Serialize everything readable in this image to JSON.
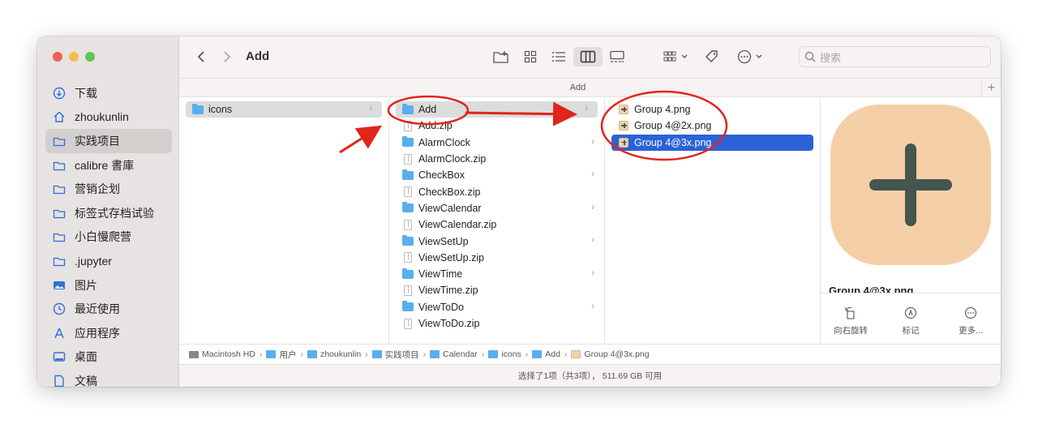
{
  "window": {
    "title": "Add",
    "path_title": "Add",
    "search_placeholder": "搜索"
  },
  "sidebar": {
    "items": [
      {
        "label": "下载",
        "icon": "download-icon"
      },
      {
        "label": "zhoukunlin",
        "icon": "home-icon"
      },
      {
        "label": "实践项目",
        "icon": "folder-icon",
        "selected": true
      },
      {
        "label": "calibre 書庫",
        "icon": "folder-icon"
      },
      {
        "label": "营销企划",
        "icon": "folder-icon"
      },
      {
        "label": "标签式存档试验",
        "icon": "folder-icon"
      },
      {
        "label": "小白慢爬营",
        "icon": "folder-icon"
      },
      {
        "label": ".jupyter",
        "icon": "folder-icon"
      },
      {
        "label": "图片",
        "icon": "photo-icon"
      },
      {
        "label": "最近使用",
        "icon": "clock-icon"
      },
      {
        "label": "应用程序",
        "icon": "apps-icon"
      },
      {
        "label": "桌面",
        "icon": "desktop-icon"
      },
      {
        "label": "文稿",
        "icon": "document-icon"
      }
    ]
  },
  "columns": {
    "col1": [
      {
        "label": "icons",
        "type": "folder",
        "chevron": true,
        "selected": "gray"
      }
    ],
    "col2": [
      {
        "label": "Add",
        "type": "folder",
        "chevron": true,
        "selected": "gray"
      },
      {
        "label": "Add.zip",
        "type": "zip"
      },
      {
        "label": "AlarmClock",
        "type": "folder",
        "chevron": true
      },
      {
        "label": "AlarmClock.zip",
        "type": "zip"
      },
      {
        "label": "CheckBox",
        "type": "folder",
        "chevron": true
      },
      {
        "label": "CheckBox.zip",
        "type": "zip"
      },
      {
        "label": "ViewCalendar",
        "type": "folder",
        "chevron": true
      },
      {
        "label": "ViewCalendar.zip",
        "type": "zip"
      },
      {
        "label": "ViewSetUp",
        "type": "folder",
        "chevron": true
      },
      {
        "label": "ViewSetUp.zip",
        "type": "zip"
      },
      {
        "label": "ViewTime",
        "type": "folder",
        "chevron": true
      },
      {
        "label": "ViewTime.zip",
        "type": "zip"
      },
      {
        "label": "ViewToDo",
        "type": "folder",
        "chevron": true
      },
      {
        "label": "ViewToDo.zip",
        "type": "zip"
      }
    ],
    "col3": [
      {
        "label": "Group 4.png",
        "type": "png"
      },
      {
        "label": "Group 4@2x.png",
        "type": "png"
      },
      {
        "label": "Group 4@3x.png",
        "type": "png",
        "selected": "blue"
      }
    ]
  },
  "preview": {
    "filename": "Group 4@3x.png",
    "image_bg": "#f4cfa6",
    "image_fg": "#45554f",
    "actions": [
      {
        "label": "向右旋转",
        "icon": "rotate-icon"
      },
      {
        "label": "标记",
        "icon": "markup-icon"
      },
      {
        "label": "更多...",
        "icon": "more-icon"
      }
    ]
  },
  "breadcrumb": [
    {
      "label": "Macintosh HD",
      "icon": "disk-icon"
    },
    {
      "label": "用户",
      "icon": "folder-icon"
    },
    {
      "label": "zhoukunlin",
      "icon": "folder-icon"
    },
    {
      "label": "实践项目",
      "icon": "folder-icon"
    },
    {
      "label": "Calendar",
      "icon": "folder-icon"
    },
    {
      "label": "icons",
      "icon": "folder-icon"
    },
    {
      "label": "Add",
      "icon": "folder-icon"
    },
    {
      "label": "Group 4@3x.png",
      "icon": "png-icon"
    }
  ],
  "status": "选择了1项（共3项），  511.69 GB 可用",
  "colors": {
    "accent": "#2b62d8",
    "folder": "#5aaeed",
    "annotation": "#e0251b"
  }
}
